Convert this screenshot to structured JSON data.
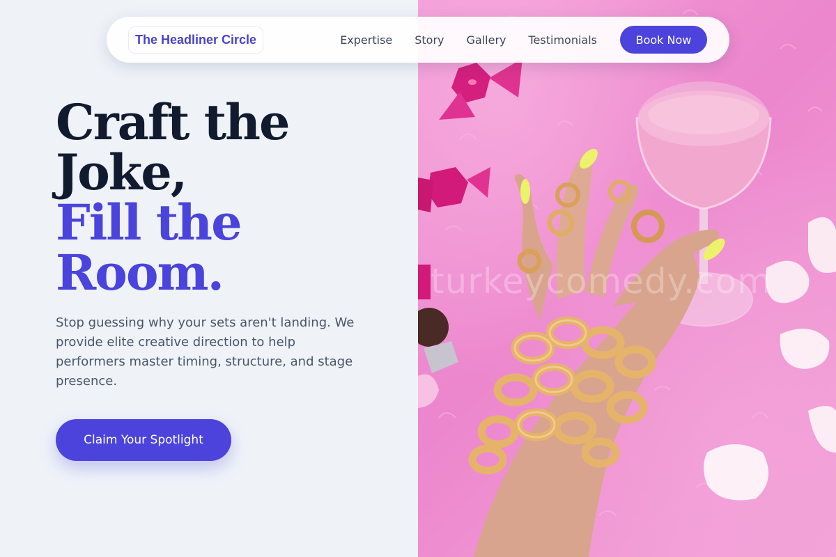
{
  "nav": {
    "brand": "The Headliner Circle",
    "links": [
      "Expertise",
      "Story",
      "Gallery",
      "Testimonials"
    ],
    "cta_label": "Book Now"
  },
  "hero": {
    "headline_line1": "Craft the",
    "headline_line2": "Joke,",
    "headline_accent_line1": "Fill the",
    "headline_accent_line2": "Room.",
    "description": "Stop guessing why your sets aren't landing. We provide elite creative direction to help performers master timing, structure, and stage presence.",
    "cta_label": "Claim Your Spotlight"
  },
  "image": {
    "watermark": "turkeycomedy.com"
  },
  "colors": {
    "accent": "#4c43dc",
    "brand": "#4a43c9",
    "heading": "#111a2e",
    "body_text": "#4a5568",
    "page_bg": "#eff3f8",
    "photo_bg": "#ef90d3"
  }
}
